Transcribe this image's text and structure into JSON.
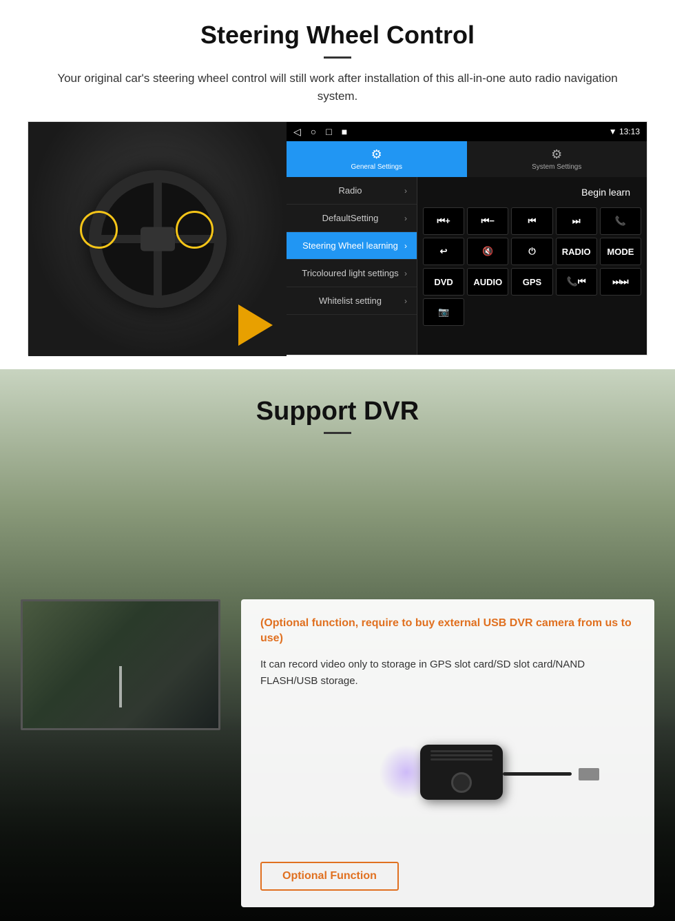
{
  "steering_section": {
    "title": "Steering Wheel Control",
    "description": "Your original car's steering wheel control will still work after installation of this all-in-one auto radio navigation system.",
    "android_ui": {
      "status_bar": {
        "nav_icons": [
          "◁",
          "○",
          "□",
          "■"
        ],
        "right_text": "▼  13:13"
      },
      "tabs": [
        {
          "label": "General Settings",
          "icon": "⚙",
          "active": true
        },
        {
          "label": "System Settings",
          "icon": "🔧",
          "active": false
        }
      ],
      "menu_items": [
        {
          "label": "Radio",
          "active": false
        },
        {
          "label": "DefaultSetting",
          "active": false
        },
        {
          "label": "Steering Wheel learning",
          "active": true
        },
        {
          "label": "Tricoloured light settings",
          "active": false
        },
        {
          "label": "Whitelist setting",
          "active": false
        }
      ],
      "begin_learn_label": "Begin learn",
      "control_buttons": [
        "⏮+",
        "⏮−",
        "⏮",
        "⏭",
        "📞",
        "↩",
        "🔇",
        "⏻",
        "RADIO",
        "MODE",
        "DVD",
        "AUDIO",
        "GPS",
        "📞⏮",
        "⏭⏭",
        "📷"
      ]
    }
  },
  "dvr_section": {
    "title": "Support DVR",
    "optional_text": "(Optional function, require to buy external USB DVR camera from us to use)",
    "description": "It can record video only to storage in GPS slot card/SD slot card/NAND FLASH/USB storage.",
    "optional_button_label": "Optional Function"
  }
}
